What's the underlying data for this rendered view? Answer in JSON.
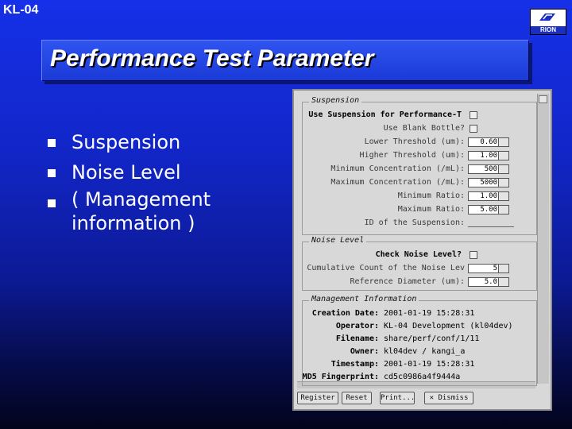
{
  "slide": {
    "id": "KL-04",
    "title": "Performance Test Parameter"
  },
  "logo": {
    "text": "RION"
  },
  "bullets": [
    {
      "line1": "Suspension"
    },
    {
      "line1": "Noise Level"
    },
    {
      "line1": "( Management",
      "line2": "information )"
    }
  ],
  "dialog": {
    "suspension": {
      "legend": "Suspension",
      "use": "Use Suspension for Performance-T",
      "rows": [
        {
          "label": "Use Blank Bottle?",
          "value": ""
        },
        {
          "label": "Lower Threshold (um):",
          "value": "0.60"
        },
        {
          "label": "Higher Threshold (um):",
          "value": "1.00"
        },
        {
          "label": "Minimum Concentration (/mL):",
          "value": "500"
        },
        {
          "label": "Maximum Concentration (/mL):",
          "value": "5000"
        },
        {
          "label": "Minimum Ratio:",
          "value": "1.00"
        },
        {
          "label": "Maximum Ratio:",
          "value": "5.00"
        },
        {
          "label": "ID of the Suspension:",
          "value": ""
        }
      ]
    },
    "noise": {
      "legend": "Noise Level",
      "check": "Check Noise Level?",
      "rows": [
        {
          "label": "Cumulative Count of the Noise Lev",
          "value": "5"
        },
        {
          "label": "Reference Diameter (um):",
          "value": "5.0"
        }
      ]
    },
    "management": {
      "legend": "Management Information",
      "rows": [
        {
          "key": "Creation Date:",
          "value": "2001-01-19 15:28:31"
        },
        {
          "key": "Operator:",
          "value": "KL-04 Development (kl04dev)"
        },
        {
          "key": "Filename:",
          "value": "share/perf/conf/1/11"
        },
        {
          "key": "Owner:",
          "value": "kl04dev / kangi_a"
        },
        {
          "key": "Timestamp:",
          "value": "2001-01-19 15:28:31"
        },
        {
          "key": "MD5 Fingerprint:",
          "value": "cd5c0986a4f9444a"
        }
      ]
    },
    "buttons": {
      "register": "Register",
      "reset": "Reset",
      "print": "Print...",
      "dismiss": "Dismiss"
    }
  }
}
